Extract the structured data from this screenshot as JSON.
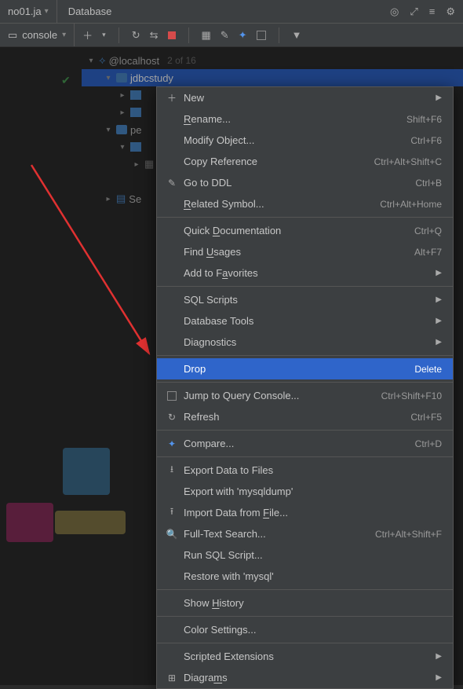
{
  "header": {
    "file_tab": "no01.ja",
    "panel_title": "Database"
  },
  "console_chip": "console",
  "tree": {
    "root_label": "@localhost",
    "root_count": "2 of 16",
    "db1": "jdbcstudy",
    "db2_prefix": "pe",
    "server_prefix": "Se"
  },
  "menu": {
    "new": "New",
    "rename": "Rename...",
    "rename_sc": "Shift+F6",
    "modify": "Modify Object...",
    "modify_sc": "Ctrl+F6",
    "copyref": "Copy Reference",
    "copyref_sc": "Ctrl+Alt+Shift+C",
    "ddl": "Go to DDL",
    "ddl_sc": "Ctrl+B",
    "related": "Related Symbol...",
    "related_sc": "Ctrl+Alt+Home",
    "quickdoc": "Quick Documentation",
    "quickdoc_sc": "Ctrl+Q",
    "usages": "Find Usages",
    "usages_sc": "Alt+F7",
    "fav": "Add to Favorites",
    "sqlscripts": "SQL Scripts",
    "dbtools": "Database Tools",
    "diag": "Diagnostics",
    "drop": "Drop",
    "drop_sc": "Delete",
    "jump": "Jump to Query Console...",
    "jump_sc": "Ctrl+Shift+F10",
    "refresh": "Refresh",
    "refresh_sc": "Ctrl+F5",
    "compare": "Compare...",
    "compare_sc": "Ctrl+D",
    "export": "Export Data to Files",
    "exportdump": "Export with 'mysqldump'",
    "importfile": "Import Data from File...",
    "fulltext": "Full-Text Search...",
    "fulltext_sc": "Ctrl+Alt+Shift+F",
    "runsql": "Run SQL Script...",
    "restore": "Restore with 'mysql'",
    "history": "Show History",
    "color": "Color Settings...",
    "scripted": "Scripted Extensions",
    "diagrams": "Diagrams"
  }
}
